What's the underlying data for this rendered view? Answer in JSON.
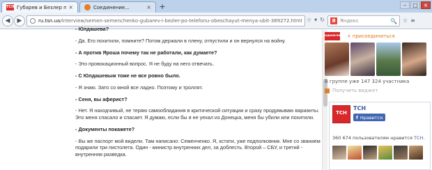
{
  "tabs": [
    {
      "title": "Губарев и Безлер по телеф...",
      "active": true
    },
    {
      "title": "Соединение...",
      "active": false
    }
  ],
  "newtab_label": "+",
  "window_controls": {
    "minimize": "–",
    "maximize": "□",
    "close": "×"
  },
  "nav": {
    "back": "◀",
    "forward": "▶",
    "url_domain": "ru.tsn.ua",
    "url_path": "/interview/semen-semenchenko-gubarev-i-bezler-po-telefonu-obeschayut-menya-ubit-389272.html",
    "url_buttons": [
      "☆",
      "▾",
      "↻"
    ],
    "search_engine_letter": "Я",
    "search_placeholder": "Яндекс",
    "search_icon": "🔍",
    "toolbar_icons": [
      "☆",
      "≡"
    ]
  },
  "article": {
    "paragraphs": [
      {
        "text": "- Юлдашева?",
        "kind": "q"
      },
      {
        "text": "- Да. Его похитили, помните? Потом держали в плену, отпустили и он вернулся на войну.",
        "kind": "a"
      },
      {
        "text": "- А против Яроша почему так не работали, как думаете?",
        "kind": "q"
      },
      {
        "text": "- Это провокационный вопрос. Я не буду на него отвечать.",
        "kind": "a"
      },
      {
        "text": "- С Юлдашевым тоже не все ровно было.",
        "kind": "q"
      },
      {
        "text": "- Я знаю. Зато со мной все ладно. Поэтому и троллят.",
        "kind": "a"
      },
      {
        "text": "- Сеня, вы аферист?",
        "kind": "q"
      },
      {
        "text": "- Нет. Я находчивый, не теряю самообладания в критической ситуации и сразу продумываю варианты. Это меня спасало и спасает. Я думаю, если бы я не уехал из Донецка, меня бы убили или похитили.",
        "kind": "a"
      },
      {
        "text": "- Документы покажете?",
        "kind": "q"
      },
      {
        "text": "- Вы же паспорт мой видели. Там написано: Семенченко. Я, кстати, уже подполковник. Мне со званием подарили три пистолета. Один - министр внутренних дел, за доблесть. Второй – СБУ, и третий - внутренняя разведка.",
        "kind": "a"
      }
    ]
  },
  "ok_widget": {
    "logo_text": "одноклассники",
    "join_plus": "+",
    "join_label": "присоединиться",
    "members_text": "В группе уже 147 324 участника",
    "get_widget": "Получить виджет"
  },
  "fb_widget": {
    "logo_text": "ТСН",
    "page_name": "ТСН",
    "like_f": "f",
    "like_label": "Нравится",
    "count_prefix": "360 674 пользователям нравится ",
    "count_page": "ТСН",
    "count_suffix": "."
  },
  "colors": {
    "chrome_tab_bg": "#bcd1ea",
    "ok_orange": "#e07a18",
    "tsn_red": "#d8282b",
    "fb_blue": "#4267b2"
  }
}
